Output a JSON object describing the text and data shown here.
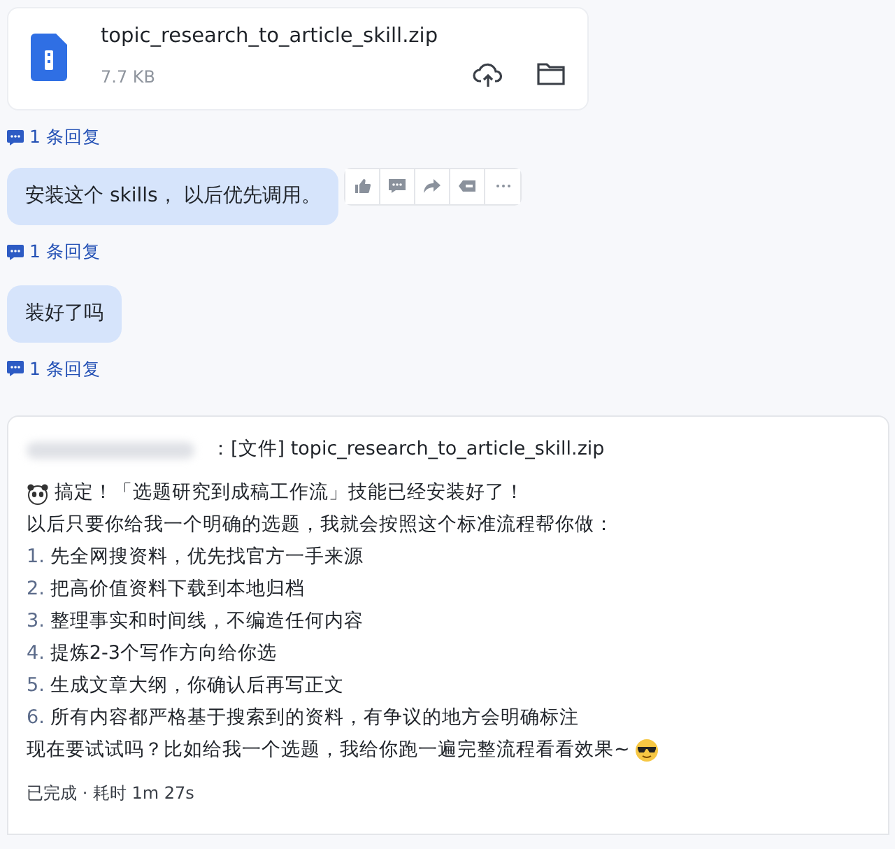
{
  "file_card": {
    "name": "topic_research_to_article_skill.zip",
    "size": "7.7 KB"
  },
  "messages": [
    {
      "kind": "reply_link",
      "text": "1 条回复"
    },
    {
      "kind": "bubble",
      "text": "安装这个 skills， 以后优先调用。",
      "toolbar": true
    },
    {
      "kind": "reply_link",
      "text": "1 条回复"
    },
    {
      "kind": "bubble",
      "text": "装好了吗",
      "toolbar": false
    },
    {
      "kind": "reply_link",
      "text": "1 条回复"
    }
  ],
  "answer": {
    "quote": "：[文件] topic_research_to_article_skill.zip",
    "lead": "搞定！「选题研究到成稿工作流」技能已经安装好了！",
    "intro": "以后只要你给我一个明确的选题，我就会按照这个标准流程帮你做：",
    "steps": [
      {
        "number": "1.",
        "text": "先全网搜资料，优先找官方一手来源"
      },
      {
        "number": "2.",
        "text": "把高价值资料下载到本地归档"
      },
      {
        "number": "3.",
        "text": "整理事实和时间线，不编造任何内容"
      },
      {
        "number": "4.",
        "text": "提炼2-3个写作方向给你选"
      },
      {
        "number": "5.",
        "text": "生成文章大纲，你确认后再写正文"
      },
      {
        "number": "6.",
        "text": "所有内容都严格基于搜索到的资料，有争议的地方会明确标注"
      }
    ],
    "closing": "现在要试试吗？比如给我一个选题，我给你跑一遍完整流程看看效果~",
    "status": "已完成 · 耗时 1m 27s"
  }
}
